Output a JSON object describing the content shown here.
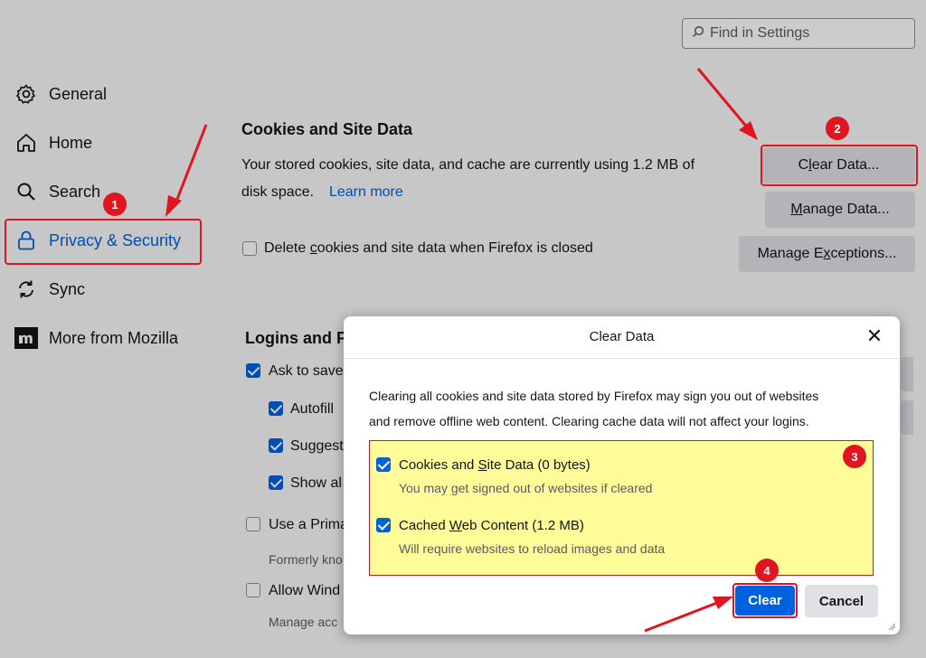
{
  "search": {
    "placeholder": "Find in Settings"
  },
  "sidebar": {
    "items": [
      {
        "label": "General",
        "icon": "gear-icon"
      },
      {
        "label": "Home",
        "icon": "home-icon"
      },
      {
        "label": "Search",
        "icon": "search-icon"
      },
      {
        "label": "Privacy & Security",
        "icon": "lock-icon"
      },
      {
        "label": "Sync",
        "icon": "sync-icon"
      },
      {
        "label": "More from Mozilla",
        "icon": "mozilla-icon"
      }
    ]
  },
  "cookies": {
    "heading": "Cookies and Site Data",
    "description_1": "Your stored cookies, site data, and cache are currently using 1.2 MB of",
    "description_2": "disk space.",
    "learn_more": "Learn more",
    "delete_checkbox": "Delete cookies and site data when Firefox is closed",
    "clear_data_button": "Clear Data...",
    "manage_data_button": "Manage Data...",
    "manage_exceptions_button": "Manage Exceptions..."
  },
  "logins": {
    "heading": "Logins and P",
    "ask_to_save": "Ask to save",
    "autofill": "Autofill",
    "suggest": "Suggest",
    "show": "Show al",
    "primary": "Use a Prima",
    "formerly": "Formerly kno",
    "allow": "Allow Wind",
    "manage": "Manage acc"
  },
  "dialog": {
    "title": "Clear Data",
    "close": "✕",
    "description_1": "Clearing all cookies and site data stored by Firefox may sign you out of websites",
    "description_2": "and remove offline web content. Clearing cache data will not affect your logins.",
    "options": [
      {
        "label": "Cookies and Site Data (0 bytes)",
        "sub": "You may get signed out of websites if cleared",
        "checked": true
      },
      {
        "label": "Cached Web Content (1.2 MB)",
        "sub": "Will require websites to reload images and data",
        "checked": true
      }
    ],
    "clear_button": "Clear",
    "cancel_button": "Cancel"
  },
  "annotations": [
    "1",
    "2",
    "3",
    "4"
  ],
  "colors": {
    "accent": "#0061e0",
    "annotation_red": "#e0151f",
    "highlight": "#fdfc98"
  }
}
